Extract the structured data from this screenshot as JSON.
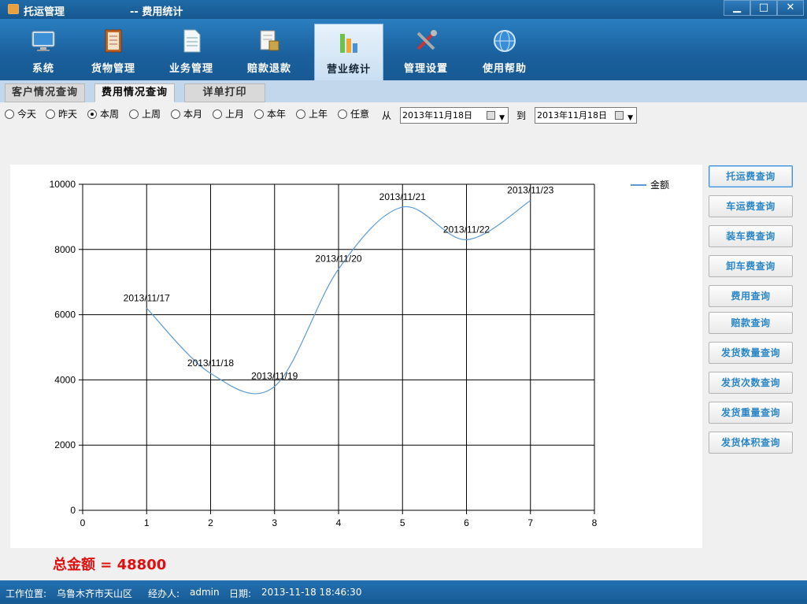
{
  "window": {
    "app_title": "托运管理",
    "page_title": "-- 费用统计",
    "min": "▁",
    "max": "□",
    "close": "✕"
  },
  "toolbar": [
    {
      "label": "系统",
      "icon": "monitor-icon"
    },
    {
      "label": "货物管理",
      "icon": "ledger-icon"
    },
    {
      "label": "业务管理",
      "icon": "document-icon"
    },
    {
      "label": "赔款退款",
      "icon": "receipt-icon"
    },
    {
      "label": "营业统计",
      "icon": "bar-chart-icon",
      "active": true
    },
    {
      "label": "管理设置",
      "icon": "tools-icon"
    },
    {
      "label": "使用帮助",
      "icon": "globe-icon"
    }
  ],
  "tabs": [
    {
      "label": "客户情况查询"
    },
    {
      "label": "费用情况查询",
      "active": true
    },
    {
      "label": "详单打印"
    }
  ],
  "filter": {
    "radios": [
      "今天",
      "昨天",
      "本周",
      "上周",
      "本月",
      "上月",
      "本年",
      "上年",
      "任意"
    ],
    "selected": "本周",
    "from_label": "从",
    "to_label": "到",
    "from_date": "2013年11月18日",
    "to_date": "2013年11月18日"
  },
  "chart_data": {
    "type": "line",
    "series": [
      {
        "name": "金额",
        "color": "#5b9bd5",
        "x": [
          1,
          2,
          3,
          4,
          5,
          6,
          7
        ],
        "values": [
          6200,
          4200,
          3800,
          7400,
          9300,
          8300,
          9500
        ],
        "point_labels": [
          "2013/11/17",
          "2013/11/18",
          "2013/11/19",
          "2013/11/20",
          "2013/11/21",
          "2013/11/22",
          "2013/11/23"
        ]
      }
    ],
    "xlim": [
      0,
      8
    ],
    "ylim": [
      0,
      10000
    ],
    "x_ticks": [
      "0",
      "1",
      "2",
      "3",
      "4",
      "5",
      "6",
      "7",
      "8"
    ],
    "y_ticks": [
      "0",
      "2000",
      "4000",
      "6000",
      "8000",
      "10000"
    ],
    "grid": true,
    "legend_position": "top-right"
  },
  "side_buttons": [
    "托运费查询",
    "车运费查询",
    "装车费查询",
    "卸车费查询",
    "费用查询",
    "赔款查询",
    "发货数量查询",
    "发货次数查询",
    "发货重量查询",
    "发货体积查询"
  ],
  "total_text": "总金额 = 48800",
  "status": {
    "location_label": "工作位置:",
    "location_value": "乌鲁木齐市天山区",
    "operator_label": "经办人:",
    "operator_value": "admin",
    "date_label": "日期:",
    "date_value": "2013-11-18 18:46:30"
  }
}
